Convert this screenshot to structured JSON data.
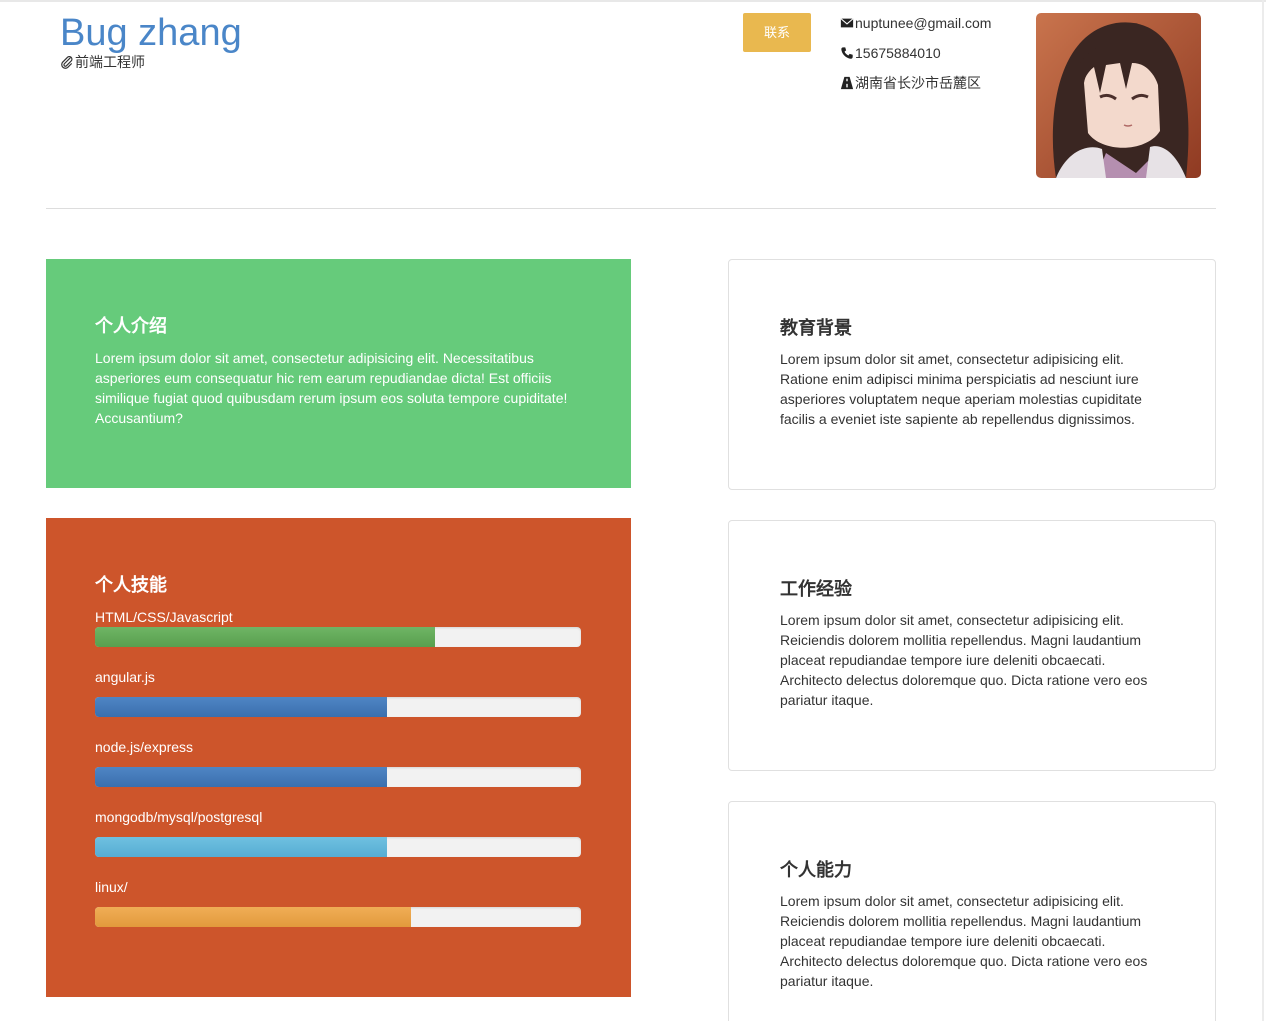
{
  "header": {
    "name": "Bug zhang",
    "role": "前端工程师",
    "contact_button": "联系",
    "email": "nuptunee@gmail.com",
    "phone": "15675884010",
    "address": "湖南省长沙市岳麓区"
  },
  "intro": {
    "title": "个人介绍",
    "text": "Lorem ipsum dolor sit amet, consectetur adipisicing elit. Necessitatibus asperiores eum consequatur hic rem earum repudiandae dicta! Est officiis similique fugiat quod quibusdam rerum ipsum eos soluta tempore cupiditate! Accusantium?"
  },
  "skills": {
    "title": "个人技能",
    "items": [
      {
        "label": "HTML/CSS/Javascript",
        "progress": 0.7,
        "color": "#5fa955"
      },
      {
        "label": "angular.js",
        "progress": 0.6,
        "color": "#4177b8"
      },
      {
        "label": "node.js/express",
        "progress": 0.6,
        "color": "#4177b8"
      },
      {
        "label": "mongodb/mysql/postgresql",
        "progress": 0.6,
        "color": "#5fb6da"
      },
      {
        "label": "linux/",
        "progress": 0.65,
        "color": "#e9a348"
      }
    ]
  },
  "education": {
    "title": "教育背景",
    "text": "Lorem ipsum dolor sit amet, consectetur adipisicing elit. Ratione enim adipisci minima perspiciatis ad nesciunt iure asperiores voluptatem neque aperiam molestias cupiditate facilis a eveniet iste sapiente ab repellendus dignissimos."
  },
  "work": {
    "title": "工作经验",
    "text": "Lorem ipsum dolor sit amet, consectetur adipisicing elit. Reiciendis dolorem mollitia repellendus. Magni laudantium placeat repudiandae tempore iure deleniti obcaecati. Architecto delectus doloremque quo. Dicta ratione vero eos pariatur itaque."
  },
  "ability": {
    "title": "个人能力",
    "text": "Lorem ipsum dolor sit amet, consectetur adipisicing elit. Reiciendis dolorem mollitia repellendus. Magni laudantium placeat repudiandae tempore iure deleniti obcaecati. Architecto delectus doloremque quo. Dicta ratione vero eos pariatur itaque."
  },
  "colors": {
    "name_blue": "#4a86c8",
    "contact_button": "#e9b84f",
    "intro_panel": "#66cb7b",
    "skills_panel": "#cd552b"
  },
  "icons": {
    "role": "paperclip-icon",
    "email": "envelope-icon",
    "phone": "phone-icon",
    "address": "road-icon"
  }
}
